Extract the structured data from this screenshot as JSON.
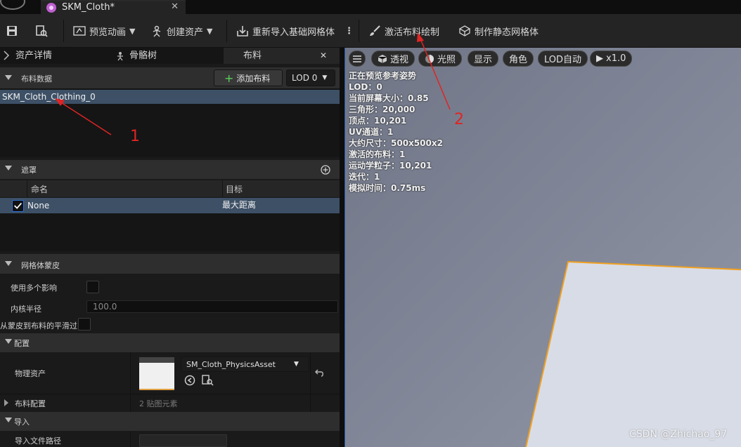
{
  "tab": {
    "title": "SKM_Cloth*",
    "close": "✕"
  },
  "toolbar": {
    "preview_anim": "预览动画",
    "create_asset": "创建资产",
    "reimport": "重新导入基础网格体",
    "more": "⋮",
    "activate_cloth_paint": "激活布料绘制",
    "make_static_mesh": "制作静态网格体"
  },
  "panel_tabs": {
    "asset_details": "资产详情",
    "skeleton_tree": "骨骼树",
    "cloth": "布料",
    "close": "✕"
  },
  "cloth_data": {
    "title": "布料数据",
    "add_button": "添加布料",
    "lod_select": "LOD 0",
    "item": "SKM_Cloth_Clothing_0"
  },
  "masks": {
    "title": "遮罩",
    "col_name": "命名",
    "col_target": "目标",
    "row_name": "None",
    "row_target": "最大距离",
    "row_checked": true
  },
  "mesh_skin": {
    "title": "网格体蒙皮",
    "use_multi_influence": "使用多个影响",
    "kernel_radius": "内核半径",
    "kernel_value": "100.0",
    "smooth_from_skin": "从蒙皮到布料的平滑过"
  },
  "config": {
    "title": "配置",
    "physics_asset": "物理资产",
    "physics_asset_value": "SM_Cloth_PhysicsAsset",
    "cloth_config": "布料配置",
    "cloth_config_value": "2 贴图元素"
  },
  "import": {
    "title": "导入",
    "import_path": "导入文件路径"
  },
  "viewport": {
    "buttons": [
      "透视",
      "光照",
      "显示",
      "角色",
      "LOD自动",
      "x1.0"
    ],
    "stats": [
      "正在预览参考姿势",
      "LOD：0",
      "当前屏幕大小：0.85",
      "三角形：20,000",
      "顶点：10,201",
      "UV通道：1",
      "大约尺寸：500x500x2",
      "激活的布料：1",
      "运动学粒子：10,201",
      "迭代：1",
      "模拟时间：0.75ms"
    ]
  },
  "annotations": {
    "one": "1",
    "two": "2"
  },
  "watermark": "CSDN @Zhichao_97",
  "colors": {
    "selection": "#3d5066",
    "plane_outline": "#f0a020",
    "annotation": "#e02424"
  }
}
